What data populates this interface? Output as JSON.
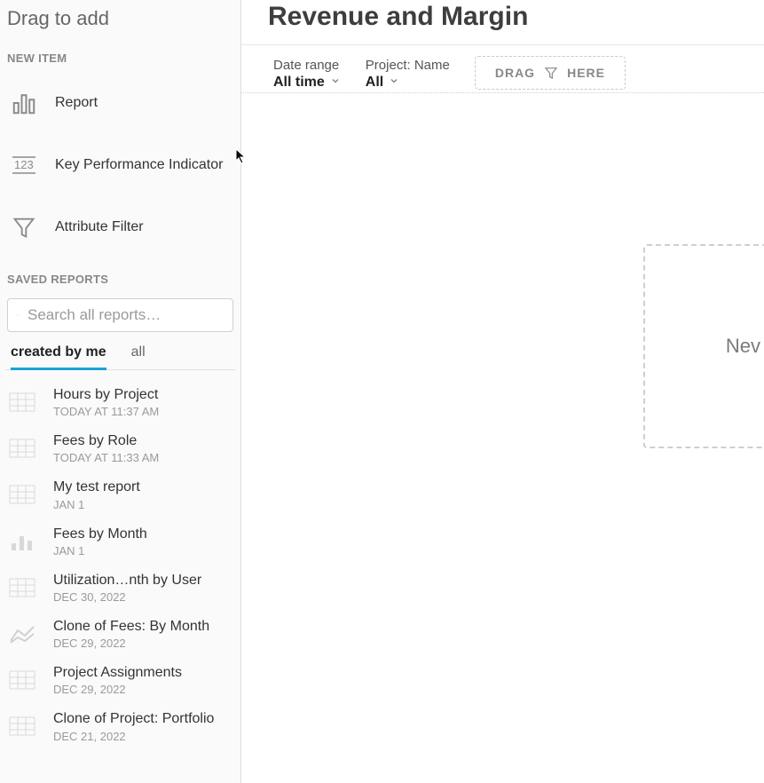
{
  "sidebar": {
    "header": "Drag to add",
    "new_item_label": "NEW ITEM",
    "saved_reports_label": "SAVED REPORTS",
    "items": [
      {
        "label": "Report",
        "icon": "bar-chart-icon"
      },
      {
        "label": "Key Performance Indicator",
        "icon": "kpi-number-icon"
      },
      {
        "label": "Attribute Filter",
        "icon": "funnel-icon"
      }
    ],
    "search": {
      "placeholder": "Search all reports…"
    },
    "tabs": {
      "created_by_me": "created by me",
      "all": "all",
      "active": "created_by_me"
    },
    "reports": [
      {
        "name": "Hours by Project",
        "time": "TODAY AT 11:37 AM",
        "thumb": "table"
      },
      {
        "name": "Fees by Role",
        "time": "TODAY AT 11:33 AM",
        "thumb": "table"
      },
      {
        "name": "My test report",
        "time": "JAN 1",
        "thumb": "table"
      },
      {
        "name": "Fees by Month",
        "time": "JAN 1",
        "thumb": "bar"
      },
      {
        "name": "Utilization…nth by User",
        "time": "DEC 30, 2022",
        "thumb": "table"
      },
      {
        "name": "Clone of Fees: By Month",
        "time": "DEC 29, 2022",
        "thumb": "line"
      },
      {
        "name": "Project Assignments",
        "time": "DEC 29, 2022",
        "thumb": "table"
      },
      {
        "name": "Clone of Project: Portfolio",
        "time": "DEC 21, 2022",
        "thumb": "table"
      }
    ]
  },
  "main": {
    "title": "Revenue and Margin",
    "filters": {
      "date_range": {
        "label": "Date range",
        "value": "All time"
      },
      "project_name": {
        "label": "Project: Name",
        "value": "All"
      }
    },
    "drag_here": {
      "left": "DRAG",
      "right": "HERE"
    },
    "dropzone_text": "Nev"
  }
}
